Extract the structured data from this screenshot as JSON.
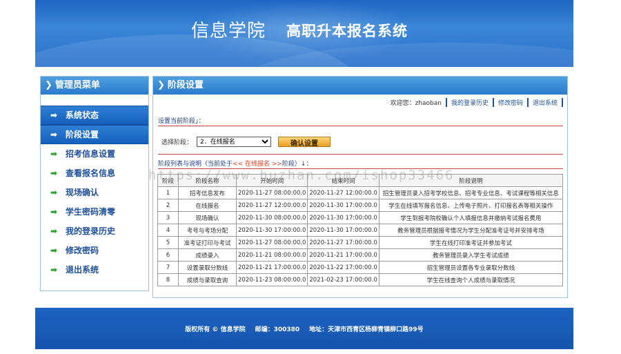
{
  "banner": {
    "school": "信息学院",
    "system": "高职升本报名系统"
  },
  "sidebar": {
    "title": "管理员菜单",
    "items": [
      {
        "label": "系统状态",
        "active": true
      },
      {
        "label": "阶段设置",
        "active": true
      },
      {
        "label": "招考信息设置",
        "active": false
      },
      {
        "label": "查看报名信息",
        "active": false
      },
      {
        "label": "现场确认",
        "active": false
      },
      {
        "label": "学生密码清零",
        "active": false
      },
      {
        "label": "我的登录历史",
        "active": false
      },
      {
        "label": "修改密码",
        "active": false
      },
      {
        "label": "退出系统",
        "active": false
      }
    ]
  },
  "main": {
    "title": "阶段设置",
    "userbar": {
      "welcome": "欢迎您：zhaoban",
      "history": "我的登录历史",
      "change_password": "修改密码",
      "logout": "退出系统"
    },
    "set_heading": "设置当前阶段」：",
    "select_label": "选择阶段：",
    "select_value": "2．在线报名",
    "confirm_label": "确认设置",
    "list_heading_prefix": "阶段列表与说明（当前处于",
    "current_stage": "<< 在线报名 >>",
    "list_heading_suffix": "阶段）↓：",
    "table": {
      "headers": [
        "阶段",
        "阶段名称",
        "开始时间",
        "结束时间",
        "阶段说明"
      ],
      "rows": [
        [
          "1",
          "招考信息发布",
          "2020-11-27 08:00:00.0",
          "2020-11-27 12:00:00.0",
          "招生管理员录入招考学校信息、招考专业信息、考试课程等相关信息"
        ],
        [
          "2",
          "在线报名",
          "2020-11-27 12:00:00.0",
          "2020-11-30 17:00:00.0",
          "学生在线填写报名信息、上传电子照片、打印报名表等相关操作"
        ],
        [
          "3",
          "现场确认",
          "2020-11-30 08:00:00.0",
          "2020-11-30 17:00:00.0",
          "学生到报考院校确认个人填报信息并缴纳考试报名费用"
        ],
        [
          "4",
          "考号与考场分配",
          "2020-11-30 17:00:00.0",
          "2020-11-30 17:00:00.0",
          "教务管理员根据报考情况为学生分配准考证号并安排考场"
        ],
        [
          "5",
          "准考证打印与考试",
          "2020-11-27 08:00:00.0",
          "2020-11-27 17:00:00.0",
          "学生在线打印准考证并参加考试"
        ],
        [
          "6",
          "成绩录入",
          "2020-11-21 08:00:00.0",
          "2020-11-21 17:00:00.0",
          "教务管理员录入学生考试成绩"
        ],
        [
          "7",
          "设置录取分数线",
          "2020-11-21 17:00:00.0",
          "2020-11-22 17:00:00.0",
          "招生管理员设置各专业录取分数线"
        ],
        [
          "8",
          "成绩与录取查询",
          "2020-11-23 08:00:00.0",
          "2021-02-23 17:00:00.0",
          "学生在线查询个人成绩与录取情况"
        ]
      ]
    }
  },
  "footer": {
    "copyright": "版权所有 © 信息学院",
    "postcode": "邮编：300380",
    "address": "地址：天津市西青区杨柳青镇柳口路99号"
  },
  "watermark": "https://www.huzhan.com/ishop33466"
}
